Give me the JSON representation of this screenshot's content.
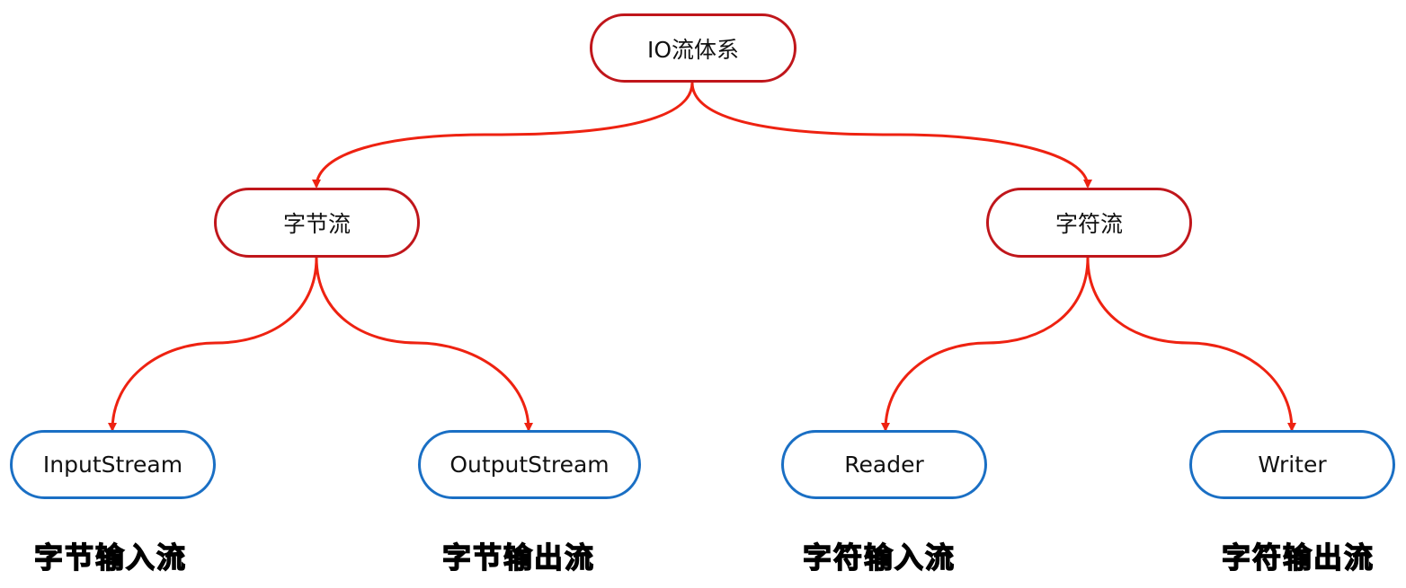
{
  "title": "IO流体系",
  "level1": [
    {
      "label": "字节流"
    },
    {
      "label": "字符流"
    }
  ],
  "level2": [
    {
      "label": "InputStream",
      "caption": "字节输入流"
    },
    {
      "label": "OutputStream",
      "caption": "字节输出流"
    },
    {
      "label": "Reader",
      "caption": "字符输入流"
    },
    {
      "label": "Writer",
      "caption": "字符输出流"
    }
  ],
  "colors": {
    "connector": "#ee2211",
    "parent_border": "#c0161b",
    "leaf_border": "#1a6fc4"
  }
}
